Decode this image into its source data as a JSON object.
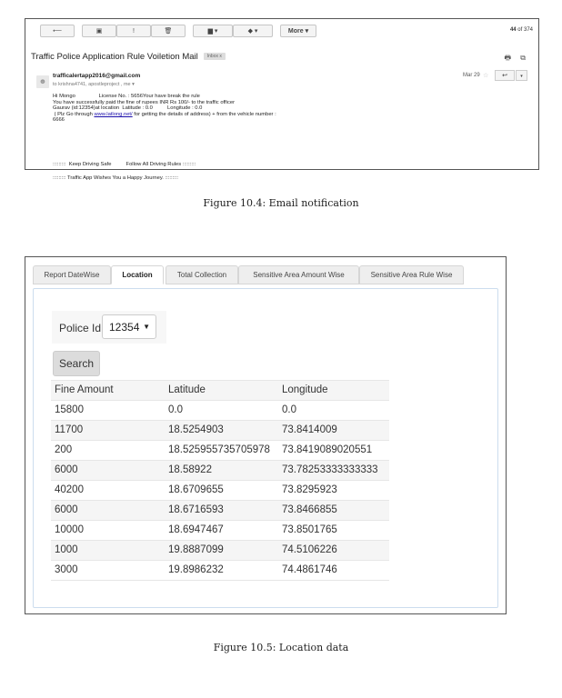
{
  "email": {
    "toolbar": {
      "back": "⟵",
      "archive": "▣",
      "spam": "!",
      "delete": "🗑",
      "move": "▆ ▾",
      "labels": "◆ ▾",
      "more": "More ▾",
      "pager_bold": "44",
      "pager_rest": " of 374"
    },
    "subject": "Traffic Police Application Rule Voiletion Mail",
    "label_chip": "Inbox  x",
    "print_icons": "🖶 ⧉",
    "sender": "trafficalertapp2016@gmail.com",
    "recipients": "to krishna4741, apostleproject , me ▾",
    "date": "Mar 29",
    "body_lines": [
      "Hi Mongo                License No. : 5656Your have break the rule",
      "You have successfully paid the fine of rupees INR Rs 100/- to the traffic officer",
      "Gaurav (id:12354)at location  Latitude : 0.0          Longitude : 0.0"
    ],
    "body_link_pre": " ( Plz Go through ",
    "body_link": "www.latlong.net/",
    "body_link_post": " for getting the details of address) + from the vehicle number :",
    "body_last": "6666",
    "footer1": ":::::::::  Keep Driving Safe          Follow All Driving Rules :::::::::",
    "footer2": "::::::::: Traffic App Wishes You a Happy Journey. :::::::::"
  },
  "caption1": "Figure 10.4: Email notification",
  "location": {
    "tabs": [
      "Report DateWise",
      "Location",
      "Total Collection",
      "Sensitive Area Amount Wise",
      "Sensitive Area Rule Wise"
    ],
    "active_tab": "Location",
    "police_label": "Police Id:",
    "police_value": "12354",
    "search_label": "Search",
    "headers": [
      "Fine Amount",
      "Latitude",
      "Longitude"
    ],
    "rows": [
      [
        "15800",
        "0.0",
        "0.0"
      ],
      [
        "11700",
        "18.5254903",
        "73.8414009"
      ],
      [
        "200",
        "18.525955735705978",
        "73.8419089020551"
      ],
      [
        "6000",
        "18.58922",
        "73.78253333333333"
      ],
      [
        "40200",
        "18.6709655",
        "73.8295923"
      ],
      [
        "6000",
        "18.6716593",
        "73.8466855"
      ],
      [
        "10000",
        "18.6947467",
        "73.8501765"
      ],
      [
        "1000",
        "19.8887099",
        "74.5106226"
      ],
      [
        "3000",
        "19.8986232",
        "74.4861746"
      ]
    ]
  },
  "caption2": "Figure 10.5: Location data"
}
